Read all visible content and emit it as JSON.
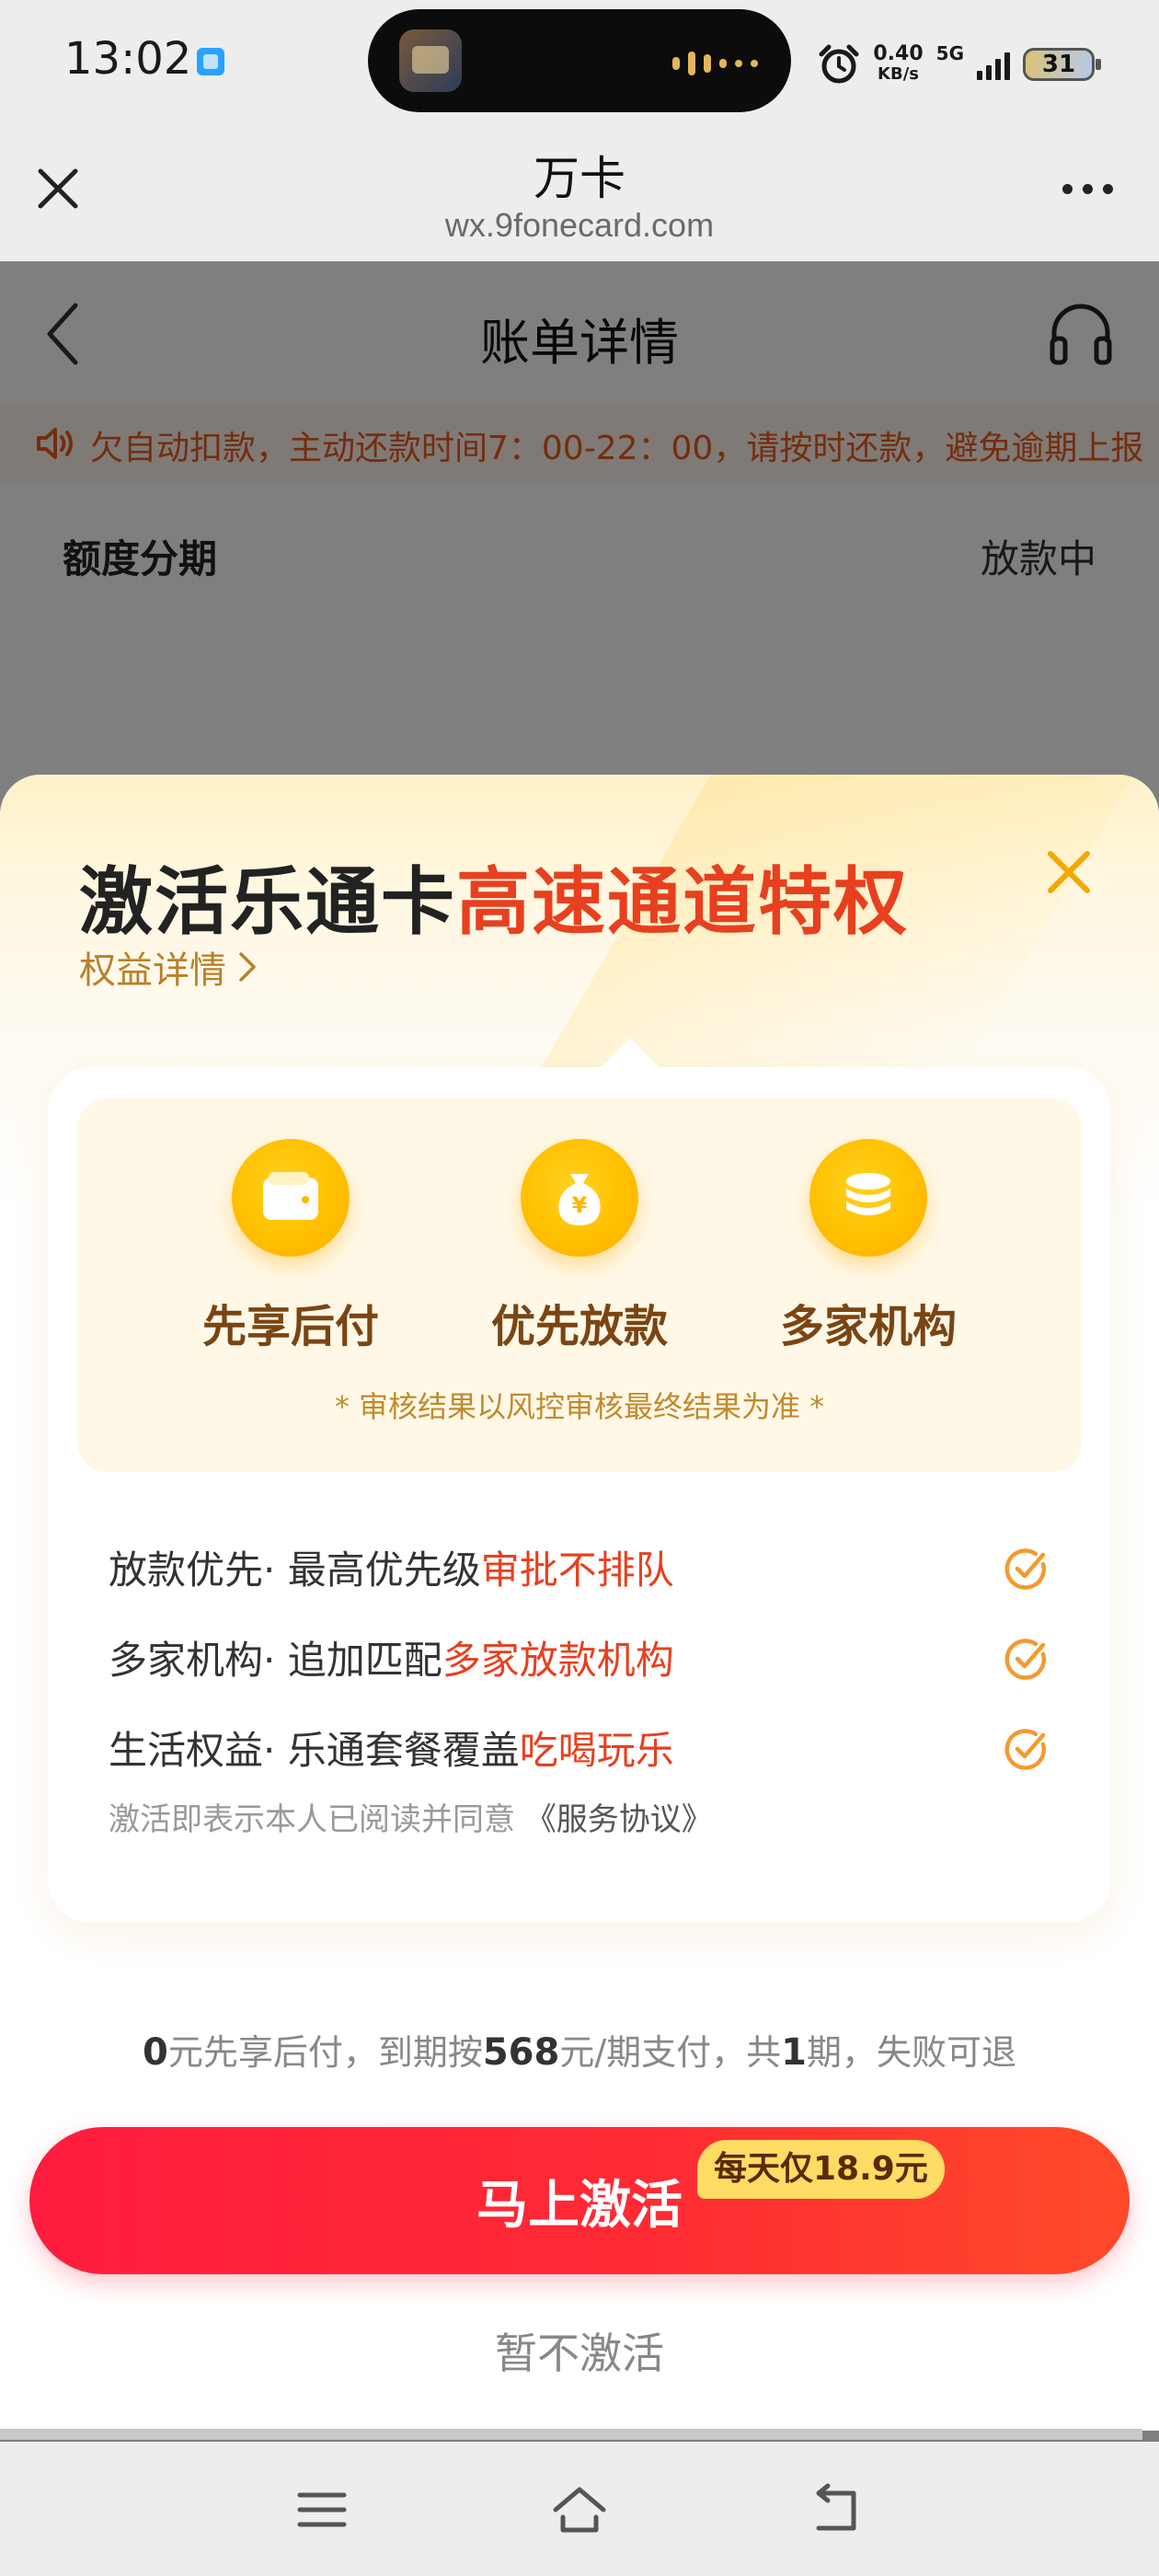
{
  "status_bar": {
    "time": "13:02",
    "net_speed_value": "0.40",
    "net_speed_unit": "KB/s",
    "network": "5G",
    "battery": "31"
  },
  "browser": {
    "title": "万卡",
    "url": "wx.9fonecard.com"
  },
  "page": {
    "title": "账单详情",
    "notice": "欠自动扣款，主动还款时间7：00-22：00，请按时还款，避免逾期上报",
    "section_label": "额度分期",
    "section_status": "放款中"
  },
  "popup": {
    "title_main": "激活乐通卡",
    "title_accent": "高速通道特权",
    "benefit_link": "权益详情",
    "features": [
      {
        "label": "先享后付",
        "icon": "wallet-icon"
      },
      {
        "label": "优先放款",
        "icon": "money-bag-icon"
      },
      {
        "label": "多家机构",
        "icon": "coins-stack-icon"
      }
    ],
    "feature_note": "* 审核结果以风控审核最终结果为准 *",
    "perks": [
      {
        "prefix": "放款优先· 最高优先级",
        "highlight": "审批不排队"
      },
      {
        "prefix": "多家机构· 追加匹配",
        "highlight": "多家放款机构"
      },
      {
        "prefix": "生活权益· 乐通套餐覆盖",
        "highlight": "吃喝玩乐"
      }
    ],
    "agreement_text": "激活即表示本人已阅读并同意",
    "agreement_link": "《服务协议》",
    "price": {
      "zero": "0",
      "part1": "元先享后付，到期按",
      "amount": "568",
      "part2": "元/期支付，共",
      "periods": "1",
      "part3": "期，失败可退"
    },
    "activate_label": "马上激活",
    "activate_badge": "每天仅18.9元",
    "skip_label": "暂不激活"
  },
  "colors": {
    "accent_red": "#e8401f",
    "button_red": "#ff1d3f",
    "gold": "#ffc000",
    "brown": "#7a4512"
  },
  "nav_bar": {
    "icons": [
      "menu-icon",
      "home-icon",
      "back-icon"
    ]
  }
}
